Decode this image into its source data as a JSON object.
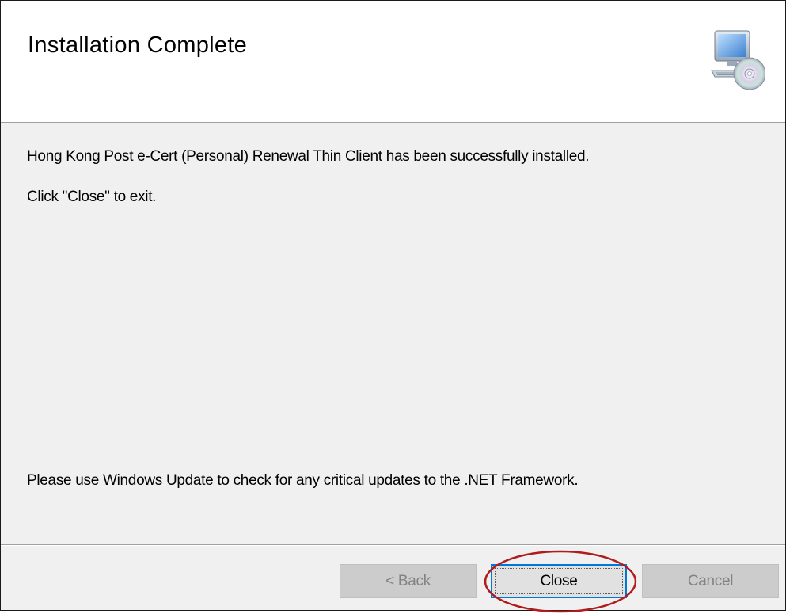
{
  "dialog": {
    "title": "Installation Complete",
    "message": "Hong Kong Post e-Cert (Personal) Renewal Thin Client has been successfully installed.",
    "instruction": "Click \"Close\" to exit.",
    "update_note": "Please use Windows Update to check for any critical updates to the .NET Framework.",
    "icon": "computer-cd-icon"
  },
  "buttons": {
    "back_label": "< Back",
    "close_label": "Close",
    "cancel_label": "Cancel",
    "back_enabled": false,
    "close_enabled": true,
    "cancel_enabled": false
  },
  "annotation": {
    "highlight_target": "close-button",
    "highlight_color": "#b01c1c"
  },
  "colors": {
    "focus_border": "#0078d7",
    "dialog_background": "#f0f0f0",
    "header_background": "#ffffff"
  }
}
